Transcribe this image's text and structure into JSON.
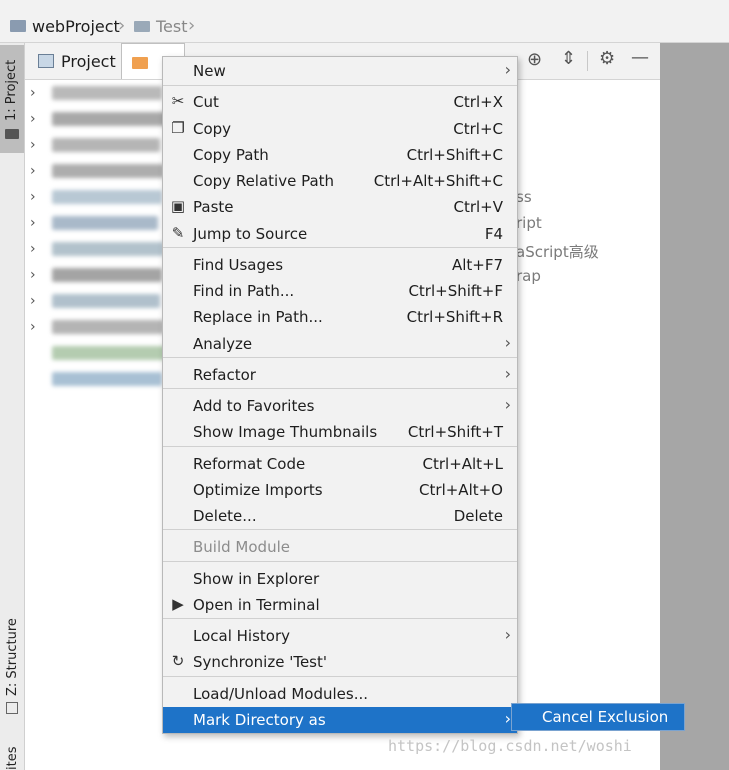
{
  "breadcrumb": {
    "project": "webProject",
    "folder": "Test"
  },
  "side": {
    "project_tab": "1: Project",
    "structure_tab": "Z: Structure",
    "favorites_tab": "ites"
  },
  "panel": {
    "title": "Project"
  },
  "background_texts": [
    "ss",
    "ript",
    "aScript高级",
    "rap"
  ],
  "context_menu": {
    "items": [
      {
        "label": "New",
        "shortcut": "",
        "submenu": true,
        "icon": ""
      },
      {
        "label": "Cut",
        "shortcut": "Ctrl+X",
        "submenu": false,
        "icon": "scissors-icon"
      },
      {
        "label": "Copy",
        "shortcut": "Ctrl+C",
        "submenu": false,
        "icon": "copy-icon"
      },
      {
        "label": "Copy Path",
        "shortcut": "Ctrl+Shift+C",
        "submenu": false,
        "icon": ""
      },
      {
        "label": "Copy Relative Path",
        "shortcut": "Ctrl+Alt+Shift+C",
        "submenu": false,
        "icon": ""
      },
      {
        "label": "Paste",
        "shortcut": "Ctrl+V",
        "submenu": false,
        "icon": "clipboard-icon"
      },
      {
        "label": "Jump to Source",
        "shortcut": "F4",
        "submenu": false,
        "icon": "pencil-icon"
      },
      {
        "label": "Find Usages",
        "shortcut": "Alt+F7",
        "submenu": false,
        "icon": ""
      },
      {
        "label": "Find in Path...",
        "shortcut": "Ctrl+Shift+F",
        "submenu": false,
        "icon": ""
      },
      {
        "label": "Replace in Path...",
        "shortcut": "Ctrl+Shift+R",
        "submenu": false,
        "icon": ""
      },
      {
        "label": "Analyze",
        "shortcut": "",
        "submenu": true,
        "icon": ""
      },
      {
        "label": "Refactor",
        "shortcut": "",
        "submenu": true,
        "icon": ""
      },
      {
        "label": "Add to Favorites",
        "shortcut": "",
        "submenu": true,
        "icon": ""
      },
      {
        "label": "Show Image Thumbnails",
        "shortcut": "Ctrl+Shift+T",
        "submenu": false,
        "icon": ""
      },
      {
        "label": "Reformat Code",
        "shortcut": "Ctrl+Alt+L",
        "submenu": false,
        "icon": ""
      },
      {
        "label": "Optimize Imports",
        "shortcut": "Ctrl+Alt+O",
        "submenu": false,
        "icon": ""
      },
      {
        "label": "Delete...",
        "shortcut": "Delete",
        "submenu": false,
        "icon": ""
      },
      {
        "label": "Build Module",
        "shortcut": "",
        "submenu": false,
        "icon": "",
        "disabled": true
      },
      {
        "label": "Show in Explorer",
        "shortcut": "",
        "submenu": false,
        "icon": ""
      },
      {
        "label": "Open in Terminal",
        "shortcut": "",
        "submenu": false,
        "icon": "terminal-icon"
      },
      {
        "label": "Local History",
        "shortcut": "",
        "submenu": true,
        "icon": ""
      },
      {
        "label": "Synchronize 'Test'",
        "shortcut": "",
        "submenu": false,
        "icon": "sync-icon"
      },
      {
        "label": "Load/Unload Modules...",
        "shortcut": "",
        "submenu": false,
        "icon": ""
      },
      {
        "label": "Mark Directory as",
        "shortcut": "",
        "submenu": true,
        "icon": "",
        "selected": true
      }
    ]
  },
  "submenu": {
    "label": "Cancel Exclusion"
  },
  "watermark": "https://blog.csdn.net/woshi",
  "colors": {
    "selection": "#1e73c8",
    "menu_bg": "#f2f2f2",
    "side_gray": "#a6a6a6"
  }
}
